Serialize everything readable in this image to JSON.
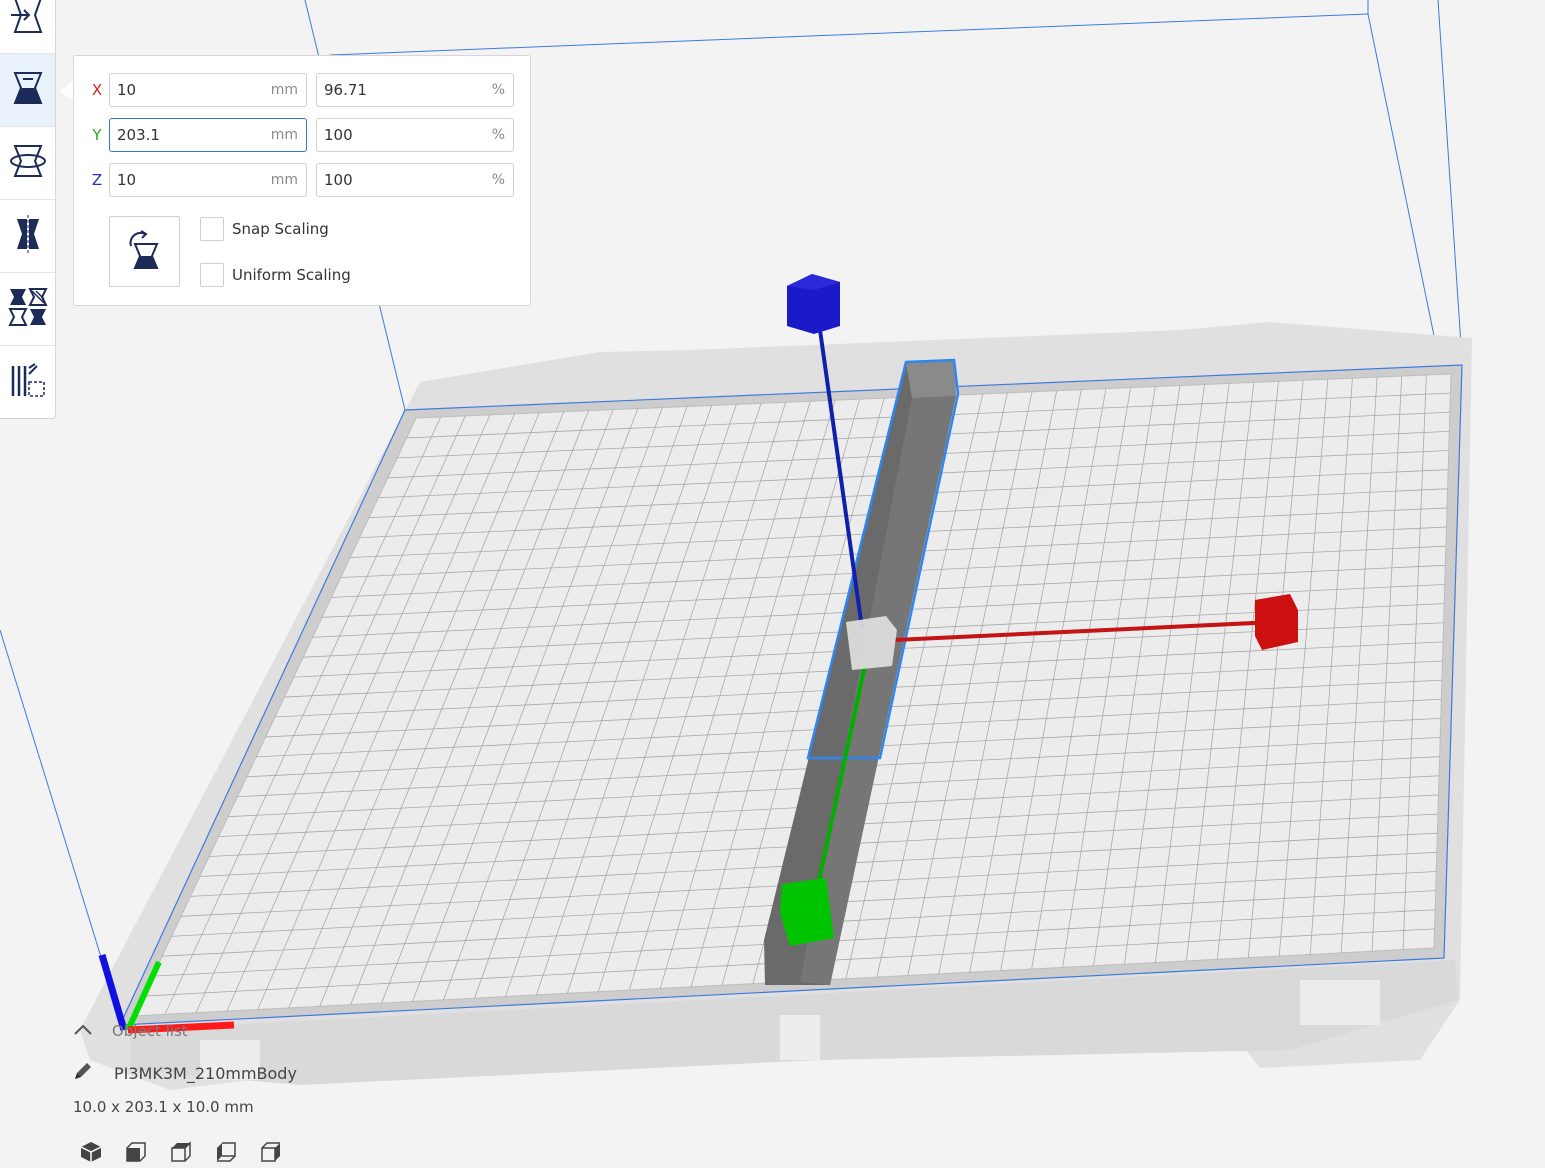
{
  "tools": [
    {
      "name": "move-tool",
      "icon": "move-icon"
    },
    {
      "name": "scale-tool",
      "icon": "scale-icon",
      "active": true
    },
    {
      "name": "rotate-tool",
      "icon": "rotate-icon"
    },
    {
      "name": "mirror-tool",
      "icon": "mirror-icon"
    },
    {
      "name": "per-model-settings-tool",
      "icon": "per-model-settings-icon"
    },
    {
      "name": "support-blocker-tool",
      "icon": "support-blocker-icon"
    }
  ],
  "scale_panel": {
    "x": {
      "axis": "X",
      "mm": "10",
      "percent": "96.71",
      "color": "#d62020"
    },
    "y": {
      "axis": "Y",
      "mm": "203.1",
      "percent": "100",
      "color": "#20b020"
    },
    "z": {
      "axis": "Z",
      "mm": "10",
      "percent": "100",
      "color": "#2030c0"
    },
    "unit_mm": "mm",
    "unit_percent": "%",
    "snap_scaling_label": "Snap Scaling",
    "snap_scaling_checked": false,
    "uniform_scaling_label": "Uniform Scaling",
    "uniform_scaling_checked": false
  },
  "object_list": {
    "header_label": "Object list",
    "object_name": "PI3MK3M_210mmBody",
    "dimensions": "10.0 x 203.1 x 10.0 mm"
  },
  "view_buttons": [
    "view-3d-icon",
    "view-front-icon",
    "view-top-icon",
    "view-left-icon",
    "view-right-icon"
  ],
  "colors": {
    "accent": "#2f7ad1",
    "axis_x": "#cc1111",
    "axis_y": "#00b000",
    "axis_z": "#1020a8",
    "model": "#6e6e6e"
  }
}
